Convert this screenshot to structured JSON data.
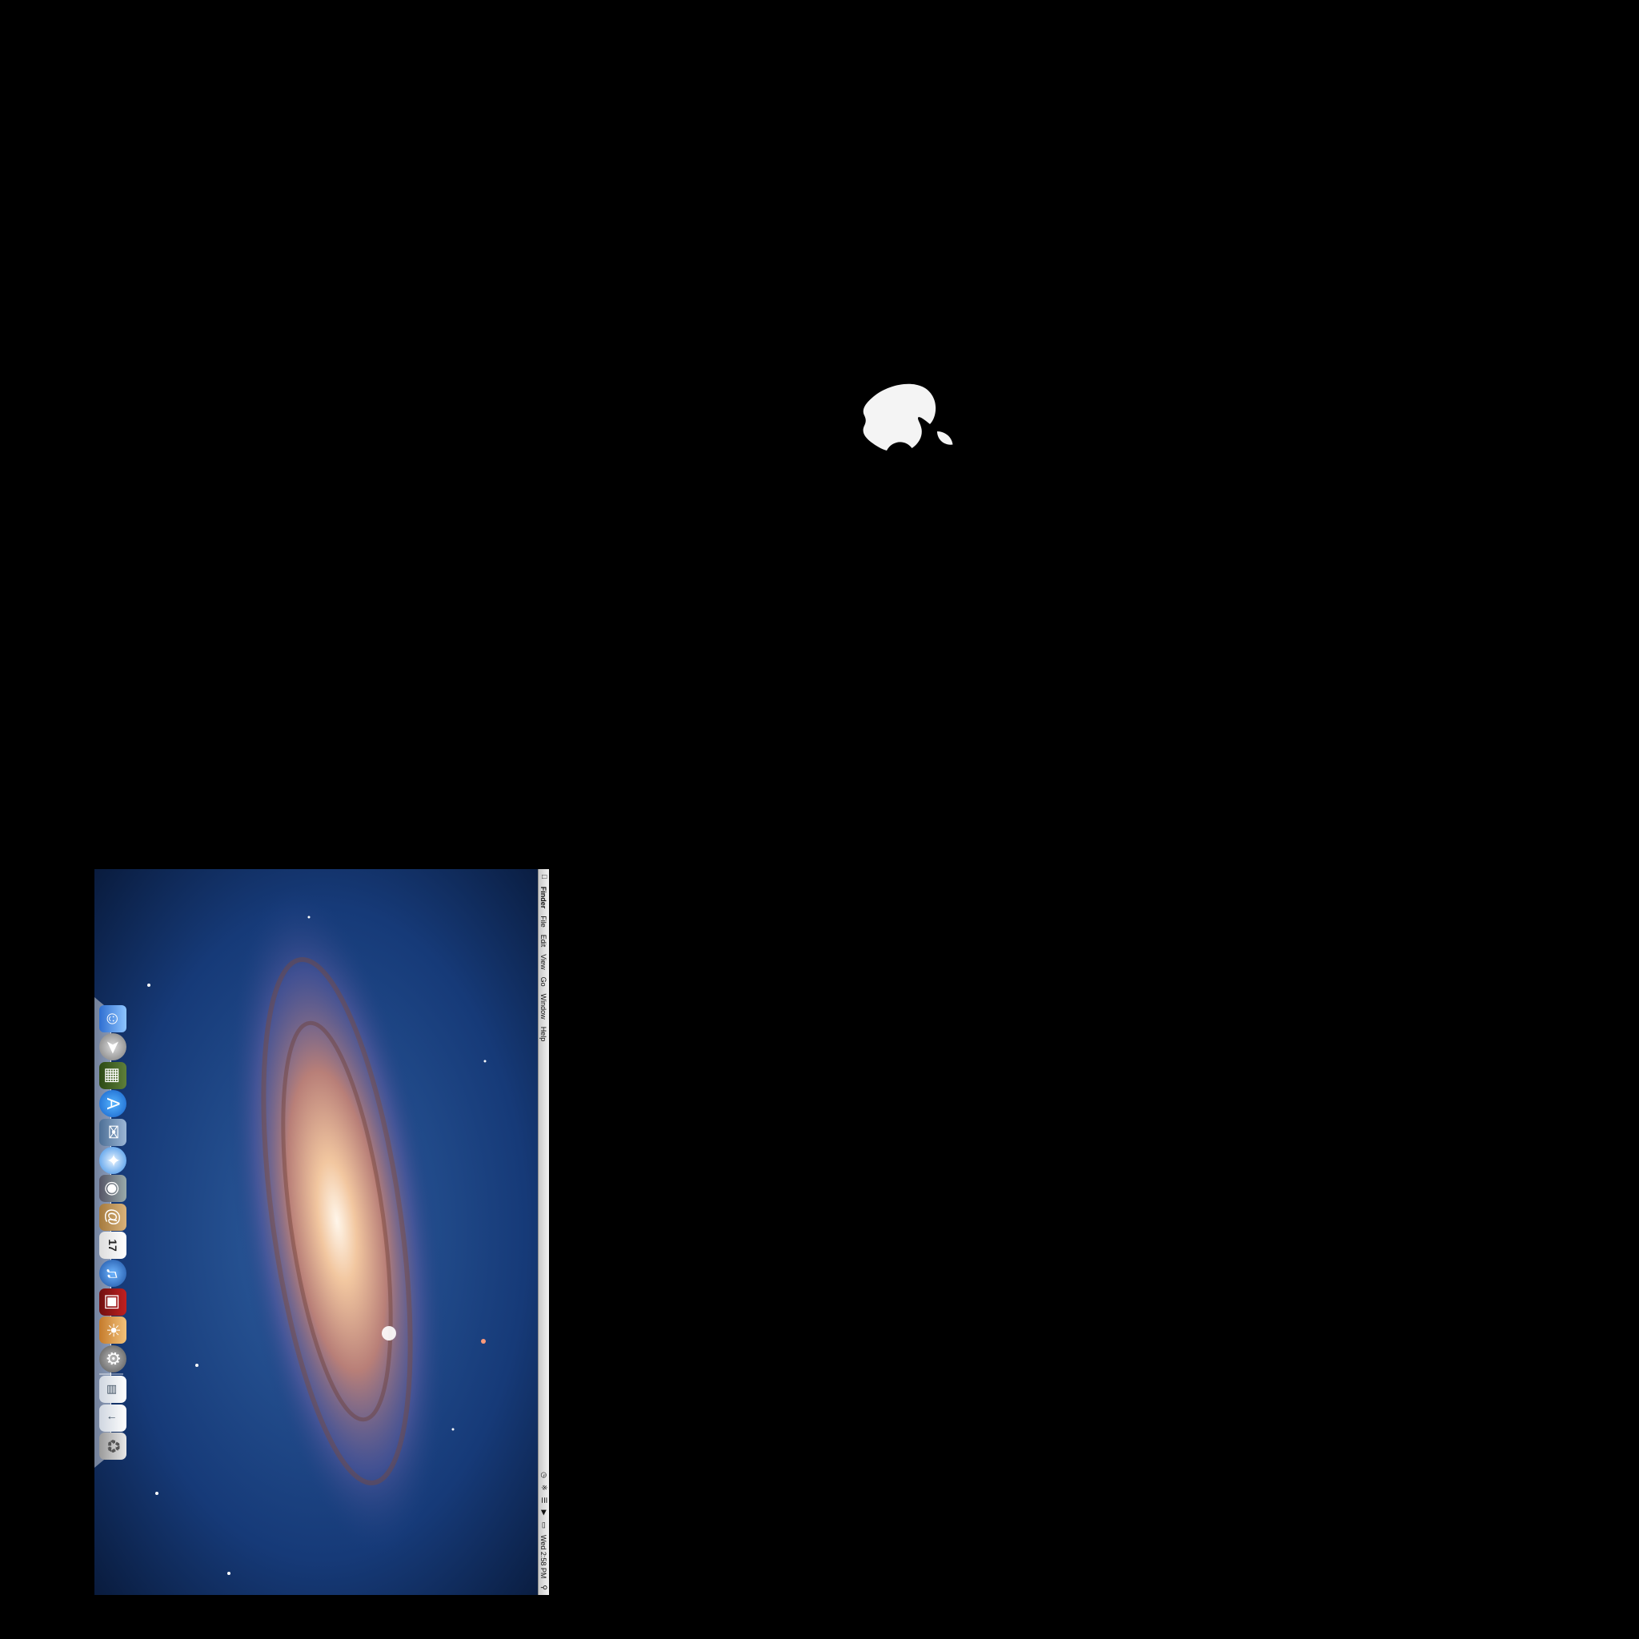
{
  "menubar": {
    "apple_label": "",
    "app_name": "Finder",
    "menus": [
      "File",
      "Edit",
      "View",
      "Go",
      "Window",
      "Help"
    ],
    "status_items": [
      "Wed 2:58 PM"
    ]
  },
  "dock": {
    "items": [
      {
        "name": "Finder",
        "icon": "finder-icon"
      },
      {
        "name": "Launchpad",
        "icon": "launchpad-icon"
      },
      {
        "name": "Mission Control",
        "icon": "mission-control-icon"
      },
      {
        "name": "App Store",
        "icon": "app-store-icon"
      },
      {
        "name": "Mail",
        "icon": "mail-icon"
      },
      {
        "name": "Safari",
        "icon": "safari-icon"
      },
      {
        "name": "FaceTime",
        "icon": "facetime-icon"
      },
      {
        "name": "Address Book",
        "icon": "contacts-icon"
      },
      {
        "name": "iCal",
        "icon": "calendar-icon",
        "label": "17"
      },
      {
        "name": "iTunes",
        "icon": "itunes-icon"
      },
      {
        "name": "Photo Booth",
        "icon": "photo-booth-icon"
      },
      {
        "name": "iPhoto",
        "icon": "iphoto-icon"
      },
      {
        "name": "System Preferences",
        "icon": "preferences-icon"
      },
      {
        "name": "Documents",
        "icon": "documents-icon"
      },
      {
        "name": "Downloads",
        "icon": "downloads-icon"
      },
      {
        "name": "Trash",
        "icon": "trash-icon"
      }
    ]
  },
  "colors": {
    "background": "#000000",
    "apple_logo": "#f4f4f4"
  }
}
